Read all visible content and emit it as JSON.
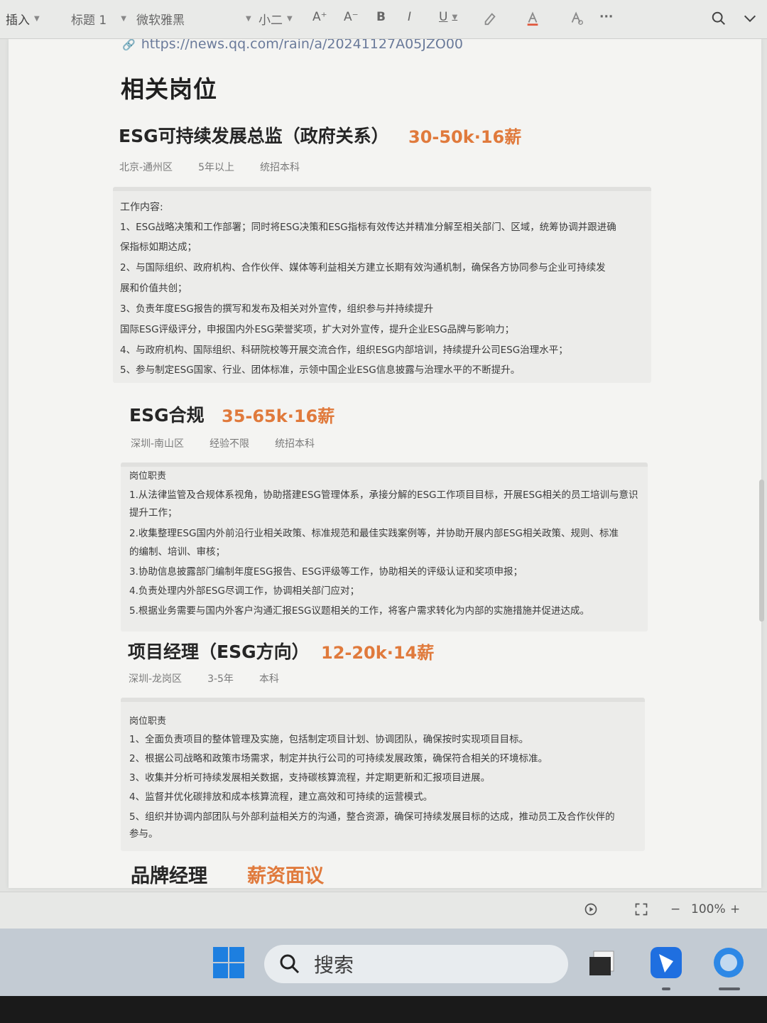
{
  "toolbar": {
    "insert": "插入",
    "style": "标题 1",
    "font": "微软雅黑",
    "size": "小二",
    "font_up": "A⁺",
    "font_down": "A⁻",
    "bold": "B",
    "italic": "I",
    "underline": "U",
    "ellipsis": "···"
  },
  "document": {
    "link": "https://news.qq.com/rain/a/20241127A05JZO00",
    "section_title": "相关岗位",
    "jobs": [
      {
        "title": "ESG可持续发展总监（政府关系）",
        "salary": "30-50k·16薪",
        "tags": [
          "北京-通州区",
          "5年以上",
          "统招本科"
        ],
        "box_heading": "工作内容:",
        "lines": [
          "1、ESG战略决策和工作部署；同时将ESG决策和ESG指标有效传达并精准分解至相关部门、区域，统筹协调并跟进确",
          "保指标如期达成；",
          "2、与国际组织、政府机构、合作伙伴、媒体等利益相关方建立长期有效沟通机制，确保各方协同参与企业可持续发",
          "展和价值共创；",
          "3、负责年度ESG报告的撰写和发布及相关对外宣传，组织参与并持续提升",
          "国际ESG评级评分，申报国内外ESG荣誉奖项，扩大对外宣传，提升企业ESG品牌与影响力；",
          "4、与政府机构、国际组织、科研院校等开展交流合作，组织ESG内部培训，持续提升公司ESG治理水平；",
          "5、参与制定ESG国家、行业、团体标准，示领中国企业ESG信息披露与治理水平的不断提升。"
        ]
      },
      {
        "title": "ESG合规",
        "salary": "35-65k·16薪",
        "tags": [
          "深圳-南山区",
          "经验不限",
          "统招本科"
        ],
        "box_heading": "岗位职责",
        "lines": [
          "1.从法律监管及合规体系视角，协助搭建ESG管理体系，承接分解的ESG工作项目目标，开展ESG相关的员工培训与意识",
          "提升工作；",
          "2.收集整理ESG国内外前沿行业相关政策、标准规范和最佳实践案例等，并协助开展内部ESG相关政策、规则、标准",
          "的编制、培训、审核；",
          "3.协助信息披露部门编制年度ESG报告、ESG评级等工作，协助相关的评级认证和奖项申报；",
          "4.负责处理内外部ESG尽调工作，协调相关部门应对；",
          "5.根据业务需要与国内外客户沟通汇报ESG议题相关的工作，将客户需求转化为内部的实施措施并促进达成。"
        ]
      },
      {
        "title": "项目经理（ESG方向）",
        "salary": "12-20k·14薪",
        "tags": [
          "深圳-龙岗区",
          "3-5年",
          "本科"
        ],
        "box_heading": "岗位职责",
        "lines": [
          "1、全面负责项目的整体管理及实施，包括制定项目计划、协调团队，确保按时实现项目目标。",
          "2、根据公司战略和政策市场需求，制定并执行公司的可持续发展政策，确保符合相关的环境标准。",
          "3、收集并分析可持续发展相关数据，支持碳核算流程，并定期更新和汇报项目进展。",
          "4、监督并优化碳排放和成本核算流程，建立高效和可持续的运营模式。",
          "5、组织并协调内部团队与外部利益相关方的沟通，整合资源，确保可持续发展目标的达成，推动员工及合作伙伴的",
          "参与。"
        ]
      },
      {
        "title": "品牌经理",
        "salary": "薪资面议"
      }
    ]
  },
  "statusbar": {
    "zoom_minus": "−",
    "zoom": "100%",
    "zoom_plus": "+"
  },
  "taskbar": {
    "search_placeholder": "搜索"
  },
  "colors": {
    "salary": "#e07a3c",
    "page_bg": "#f4f4f2",
    "taskbar_bg": "#c3cbd3",
    "windows_blue": "#1d7fe0"
  }
}
